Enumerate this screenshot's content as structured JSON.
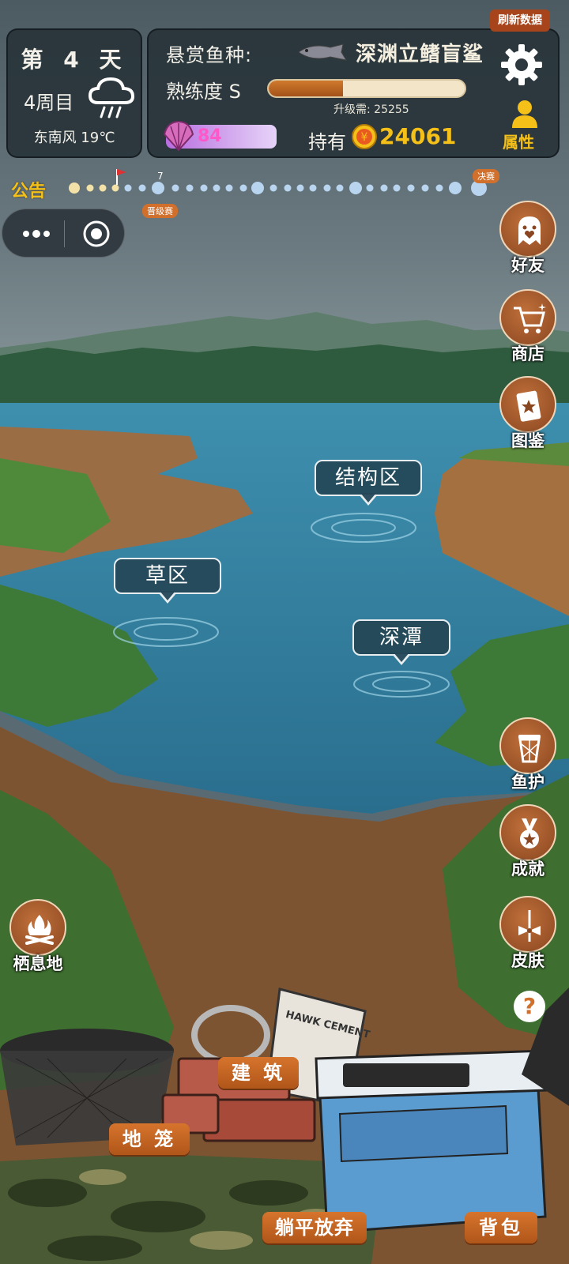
{
  "status": {
    "day": "第 4 天",
    "week": "4周目",
    "weather_icon": "rain-cloud-icon",
    "wind_temp": "东南风 19℃"
  },
  "bounty": {
    "label": "悬赏鱼种:",
    "fish_name": "深渊立鳍盲鲨",
    "refresh": "刷新数据"
  },
  "proficiency": {
    "label": "熟练度 S",
    "progress": 0.38,
    "upgrade": "升级需: 25255"
  },
  "currency": {
    "shell": "84",
    "hold_label": "持有",
    "coins": "24061"
  },
  "attr_label": "属性",
  "notice": "公告",
  "track": {
    "mark": "7",
    "promo_tag": "晋级赛",
    "final_tag": "决赛"
  },
  "side_buttons": {
    "friends": "好友",
    "shop": "商店",
    "atlas": "图鉴",
    "fish_protect": "鱼护",
    "achieve": "成就",
    "skin": "皮肤"
  },
  "zones": {
    "structure": "结构区",
    "grass": "草区",
    "deep": "深潭"
  },
  "habitat": "栖息地",
  "bottom": {
    "build": "建 筑",
    "cage": "地 笼",
    "give_up": "躺平放弃",
    "backpack": "背包"
  },
  "cement_text": "HAWK CEMENT",
  "help": "?"
}
